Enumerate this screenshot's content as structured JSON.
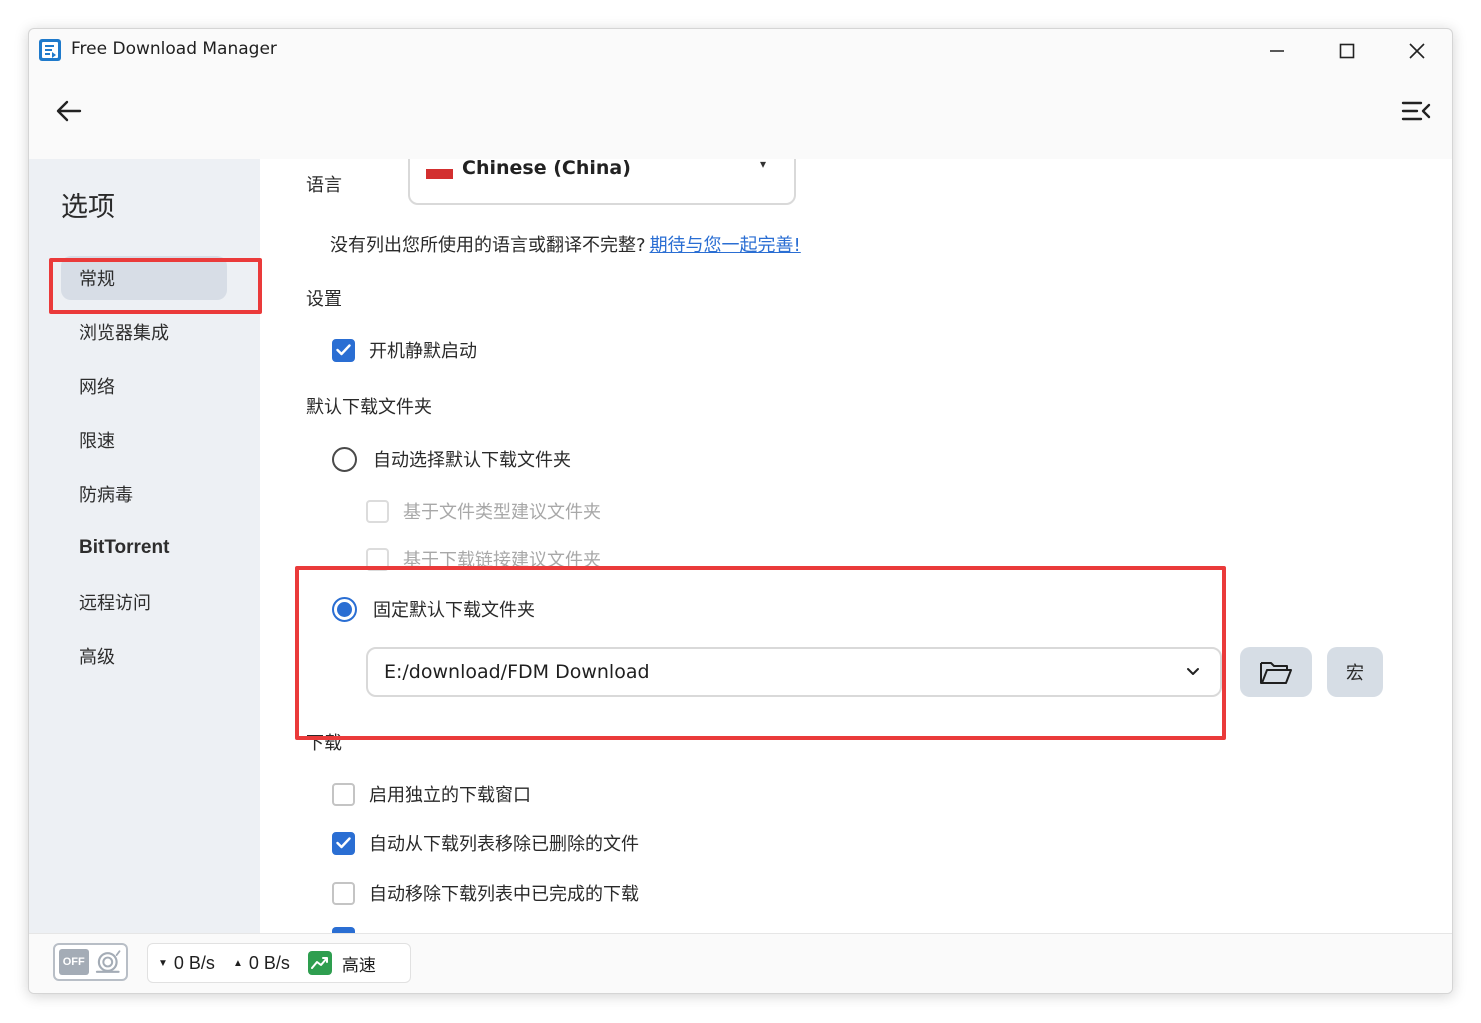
{
  "window": {
    "title": "Free Download Manager"
  },
  "sidebar": {
    "title": "选项",
    "items": [
      {
        "label": "常规"
      },
      {
        "label": "浏览器集成"
      },
      {
        "label": "网络"
      },
      {
        "label": "限速"
      },
      {
        "label": "防病毒"
      },
      {
        "label": "BitTorrent"
      },
      {
        "label": "远程访问"
      },
      {
        "label": "高级"
      }
    ],
    "active_index": 0
  },
  "content": {
    "language": {
      "label": "语言",
      "selected": "Chinese (China)",
      "note": "没有列出您所使用的语言或翻译不完整?",
      "note_link": "期待与您一起完善!"
    },
    "settings_title": "设置",
    "silent_start": {
      "label": "开机静默启动",
      "checked": true
    },
    "default_folder_title": "默认下载文件夹",
    "auto_select": {
      "label": "自动选择默认下载文件夹",
      "selected": false
    },
    "suggest_by_type": {
      "label": "基于文件类型建议文件夹",
      "checked": false
    },
    "suggest_by_link": {
      "label": "基于下载链接建议文件夹",
      "checked": false
    },
    "fixed_folder": {
      "label": "固定默认下载文件夹",
      "selected": true
    },
    "folder_path": "E:/download/FDM Download",
    "macro_button": "宏",
    "download_title": "下载",
    "separate_window": {
      "label": "启用独立的下载窗口",
      "checked": false
    },
    "remove_deleted": {
      "label": "自动从下载列表移除已删除的文件",
      "checked": true
    },
    "remove_completed": {
      "label": "自动移除下载列表中已完成的下载",
      "checked": false
    }
  },
  "status": {
    "snail_label": "OFF",
    "download_speed": "0 B/s",
    "upload_speed": "0 B/s",
    "mode": "高速"
  },
  "colors": {
    "accent": "#2a6ed3",
    "highlight": "#ea3a3a",
    "sidebar_bg": "#edf0f4",
    "mode_green": "#2e9e4f"
  }
}
